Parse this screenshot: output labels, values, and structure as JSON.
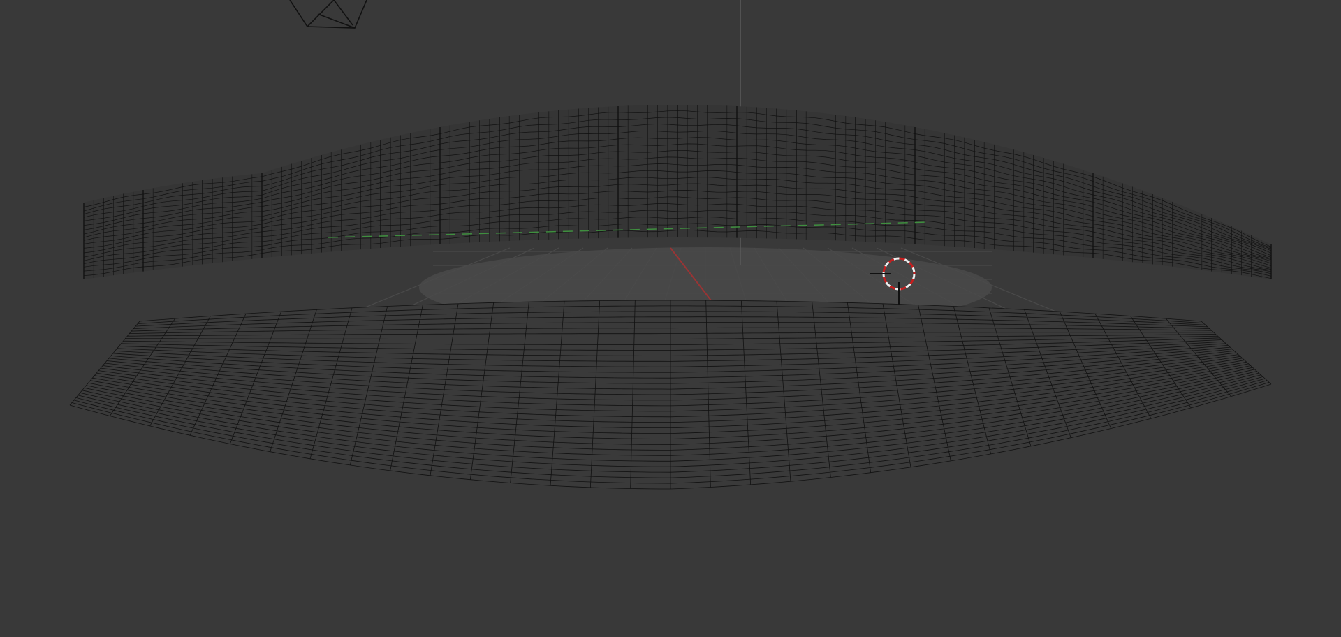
{
  "viewport": {
    "background_color": "#393939",
    "grid_color": "#4a4a4a",
    "x_axis_color": "#9a3434",
    "y_axis_color": "#3f8f3f",
    "z_axis_color": "#5a5a5a",
    "wire_color": "#111111",
    "cursor_ring_red": "#c81e1e",
    "cursor_ring_white": "#f0f0f0"
  },
  "objects": [
    {
      "name": "mobius-strip-mesh",
      "icon": "mesh-icon"
    },
    {
      "name": "camera",
      "icon": "camera-icon"
    },
    {
      "name": "3d-cursor",
      "icon": "crosshair-icon"
    }
  ]
}
